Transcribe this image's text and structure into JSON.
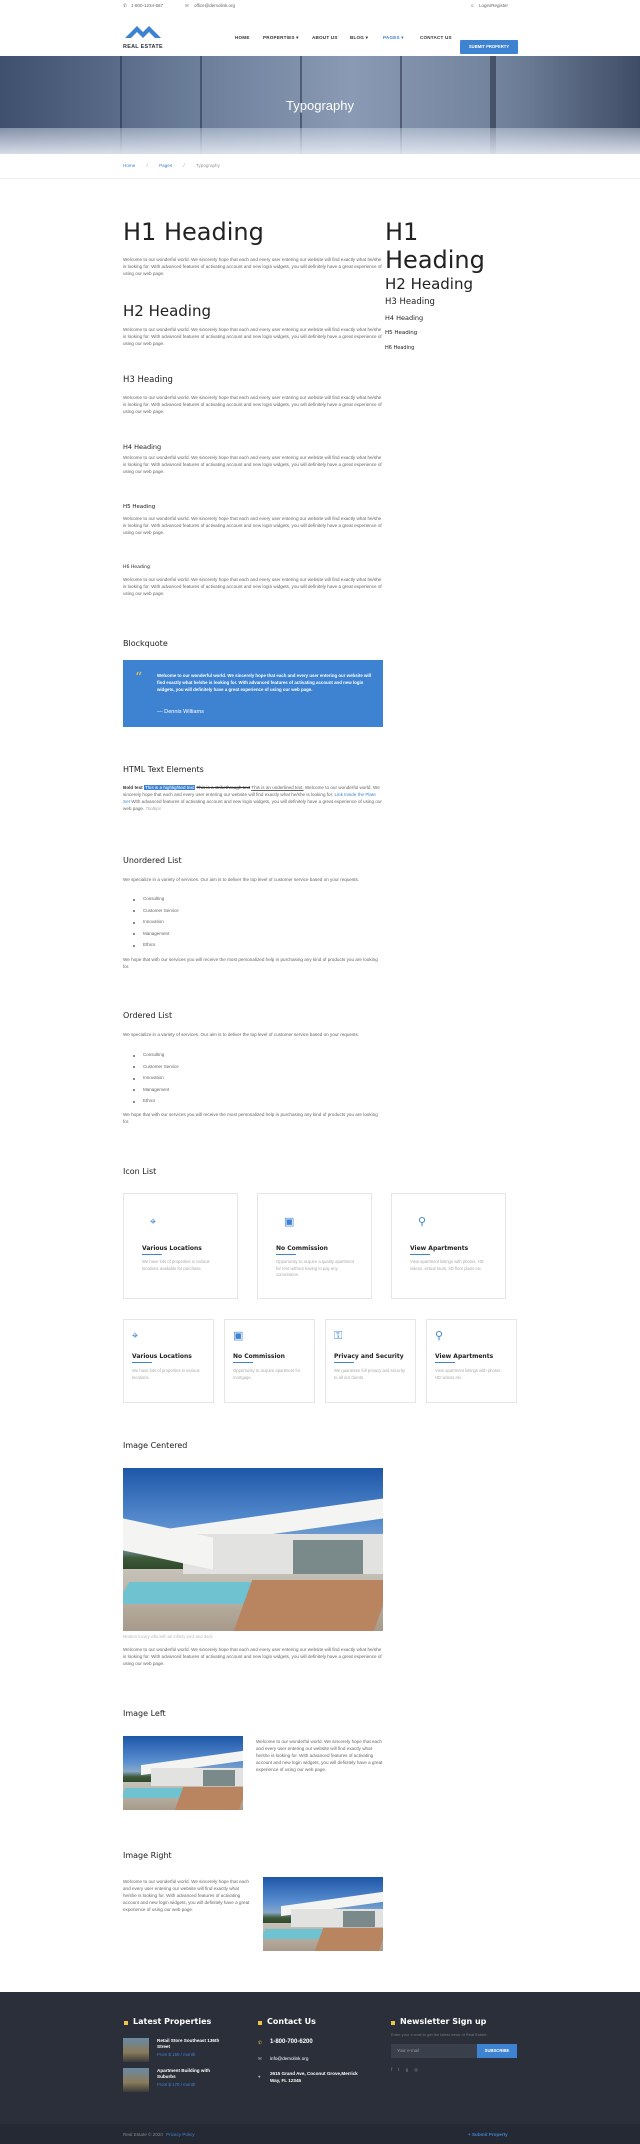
{
  "topbar": {
    "phone": "1-800-1234-567",
    "email": "office@demolink.org",
    "login": "Login/Register"
  },
  "brand": {
    "name": "REAL ESTATE"
  },
  "nav": {
    "items": [
      "HOME",
      "PROPERTIES",
      "ABOUT US",
      "BLOG",
      "PAGES",
      "CONTACT US"
    ],
    "submit": "SUBMIT PROPERTY"
  },
  "hero": {
    "title": "Typography"
  },
  "breadcrumb": {
    "home": "Home",
    "pages": "Pages",
    "current": "Typography"
  },
  "lorem": "Welcome to our wonderful world. We sincerely hope that each and every user entering our website will find exactly what he/she is looking for. With advanced features of activating account and new login widgets, you will definitely have a great experience of using our web page.",
  "headings": {
    "h1": "H1 Heading",
    "h2": "H2 Heading",
    "h3": "H3 Heading",
    "h4": "H4 Heading",
    "h5": "H5 Heading",
    "h6": "H6 Heading"
  },
  "blockquote": {
    "title": "Blockquote",
    "text": "Welcome to our wonderful world. We sincerely hope that each and every user entering our website will find exactly what he/she is looking for. With advanced features of activating account and new login widgets, you will definitely have a great experience of using our web page.",
    "author": "— Dennis Williams"
  },
  "html_text": {
    "title": "HTML Text Elements",
    "bold": "Bold text",
    "highlight": "This is a highlighted text",
    "strike": "This is a strikethrough text",
    "underline": "This is an underlined text.",
    "rest1": "Welcome to our wonderful world. We sincerely hope that each and every user entering our website will find exactly what he/she is looking for.",
    "link": "Link Inside the Plate Set",
    "rest2": "With advanced features of activating account and new login widgets, you will definitely have a great experience of using our web page.",
    "italic": "Tooltips"
  },
  "unordered": {
    "title": "Unordered List",
    "intro": "We specialize in a variety of services. Our aim is to deliver the top level of customer service based on your requests.",
    "items": [
      "Consulting",
      "Customer Service",
      "Innovation",
      "Management",
      "Ethics"
    ],
    "outro": "We hope that with our services you will receive the most personalized help in purchasing any kind of products you are looking for."
  },
  "ordered": {
    "title": "Ordered List",
    "intro": "We specialize in a variety of services. Our aim is to deliver the top level of customer service based on your requests.",
    "items": [
      "Consulting",
      "Customer Service",
      "Innovation",
      "Management",
      "Ethics"
    ],
    "outro": "We hope that with our services you will receive the most personalized help in purchasing any kind of products you are looking for."
  },
  "icon_list": {
    "title": "Icon List",
    "row1": [
      {
        "icon": "map-pin-icon",
        "title": "Various Locations",
        "text": "We have lots of properties in various locations available for purchase."
      },
      {
        "icon": "wallet-icon",
        "title": "No Commission",
        "text": "Opportunity to acquire a quality apartment for rent without having to pay any commission."
      },
      {
        "icon": "search-icon",
        "title": "View Apartments",
        "text": "View apartment listings with photos, HD videos, virtual tours, 3D floor plans etc."
      }
    ],
    "row2": [
      {
        "icon": "map-pin-icon",
        "title": "Various Locations",
        "text": "We have lots of properties in various locations."
      },
      {
        "icon": "wallet-icon",
        "title": "No Commission",
        "text": "Opportunity to acquire apartment for mortgage."
      },
      {
        "icon": "lock-icon",
        "title": "Privacy and Security",
        "text": "We guarantee full privacy and security to all our clients."
      },
      {
        "icon": "search-icon",
        "title": "View Apartments",
        "text": "View apartment listings with photos, HD videos etc."
      }
    ]
  },
  "image_centered": {
    "title": "Image Centered",
    "caption": "Modern luxury villa with an infinity pool and deck"
  },
  "image_left": {
    "title": "Image Left"
  },
  "image_right": {
    "title": "Image Right"
  },
  "footer": {
    "latest_title": "Latest Properties",
    "properties": [
      {
        "name": "Retail Store Southeast 136th Street",
        "price": "From $ 150 / month"
      },
      {
        "name": "Apartment Building with Suburbs",
        "price": "From $ 170 / month"
      }
    ],
    "contact_title": "Contact Us",
    "phone": "1-800-700-6200",
    "email": "info@demolink.org",
    "address": "2615 Grand Ave, Coconut Grove,Merrick Way, FL 12345",
    "newsletter_title": "Newsletter Sign up",
    "newsletter_text": "Enter your e-mail to get the latest news of Real Estate.",
    "email_placeholder": "Your e-mail",
    "subscribe": "SUBSCRIBE",
    "copyright": "Real Estate © 2020",
    "privacy": "Privacy Policy",
    "submit_link": "+ Submit Property"
  },
  "colors": {
    "accent": "#3e82d2",
    "gold": "#f0c24b",
    "footer": "#2b2f3a"
  }
}
